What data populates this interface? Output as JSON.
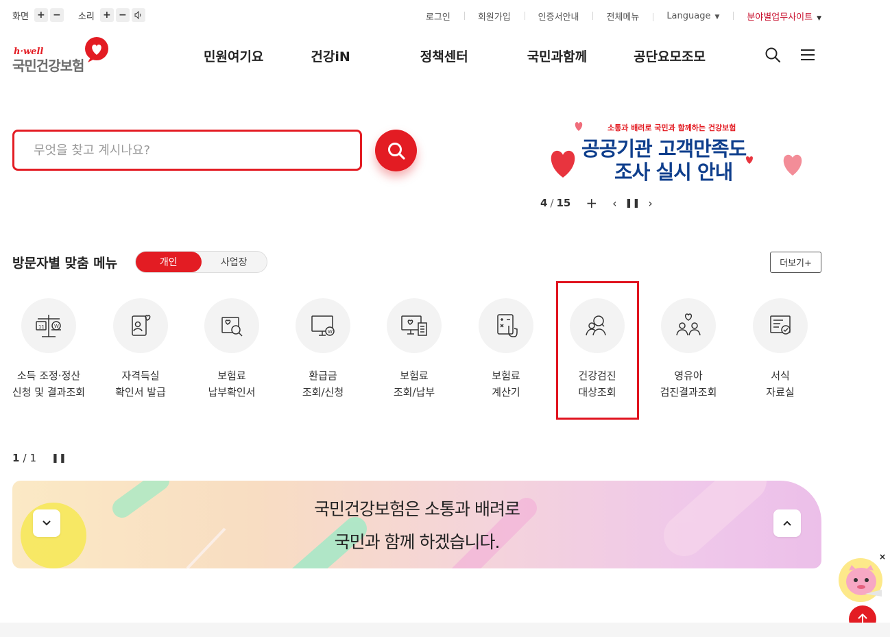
{
  "utility": {
    "screen_label": "화면",
    "sound_label": "소리",
    "links": [
      {
        "label": "로그인"
      },
      {
        "label": "회원가입"
      },
      {
        "label": "인증서안내"
      },
      {
        "label": "전체메뉴"
      },
      {
        "label": "Language"
      },
      {
        "label": "분야별업무사이트"
      }
    ]
  },
  "logo": {
    "sub": "h·well",
    "name": "국민건강보험"
  },
  "gnb": [
    "민원여기요",
    "건강iN",
    "정책센터",
    "국민과함께",
    "공단요모조모"
  ],
  "search": {
    "placeholder": "무엇을 찾고 계시나요?"
  },
  "banner": {
    "sub": "소통과 배려로 국민과 함께하는 건강보험",
    "line1": "공공기관 고객만족도",
    "line2": "조사 실시 안내",
    "current": "4",
    "total": "15"
  },
  "visitor_menu": {
    "title": "방문자별 맞춤 메뉴",
    "tabs": [
      "개인",
      "사업장"
    ],
    "active_tab": "개인",
    "more": "더보기+",
    "items": [
      {
        "l1": "소득 조정·정산",
        "l2": "신청 및 결과조회",
        "icon": "scale-icon"
      },
      {
        "l1": "자격득실",
        "l2": "확인서 발급",
        "icon": "id-card-icon"
      },
      {
        "l1": "보험료",
        "l2": "납부확인서",
        "icon": "document-search-icon"
      },
      {
        "l1": "환급금",
        "l2": "조회/신청",
        "icon": "monitor-won-icon"
      },
      {
        "l1": "보험료",
        "l2": "조회/납부",
        "icon": "monitor-receipt-icon"
      },
      {
        "l1": "보험료",
        "l2": "계산기",
        "icon": "calculator-icon"
      },
      {
        "l1": "건강검진",
        "l2": "대상조회",
        "icon": "people-search-icon"
      },
      {
        "l1": "영유아",
        "l2": "검진결과조회",
        "icon": "family-icon"
      },
      {
        "l1": "서식",
        "l2": "자료실",
        "icon": "form-check-icon"
      }
    ],
    "pager_current": "1",
    "pager_total": "1"
  },
  "slogan": {
    "line1": "국민건강보험은 소통과 배려로",
    "line2": "국민과 함께 하겠습니다."
  },
  "colors": {
    "brand_red": "#e31c23",
    "navy": "#0e3e8c"
  }
}
